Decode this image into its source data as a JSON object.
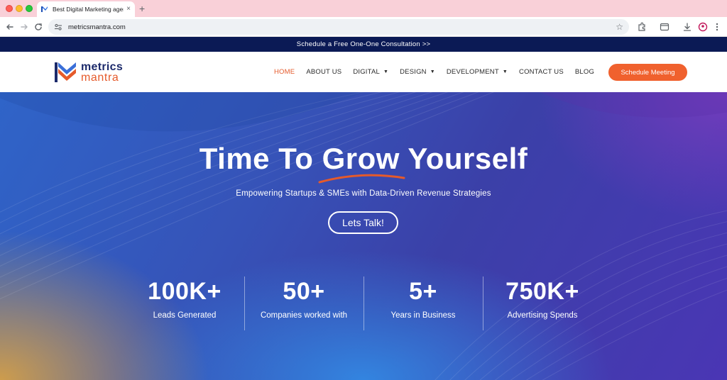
{
  "browser": {
    "tab_title": "Best Digital Marketing agency",
    "tab_close": "×",
    "new_tab": "+",
    "url": "metricsmantra.com"
  },
  "announcement": {
    "text": "Schedule a Free One-One Consultation >>"
  },
  "header": {
    "logo": {
      "line1": "metrics",
      "line2": "mantra"
    },
    "nav": [
      {
        "label": "HOME",
        "active": true,
        "dropdown": false
      },
      {
        "label": "ABOUT US",
        "active": false,
        "dropdown": false
      },
      {
        "label": "DIGITAL",
        "active": false,
        "dropdown": true
      },
      {
        "label": "DESIGN",
        "active": false,
        "dropdown": true
      },
      {
        "label": "DEVELOPMENT",
        "active": false,
        "dropdown": true
      },
      {
        "label": "CONTACT US",
        "active": false,
        "dropdown": false
      },
      {
        "label": "BLOG",
        "active": false,
        "dropdown": false
      }
    ],
    "cta_label": "Schedule Meeting"
  },
  "hero": {
    "title_part1": "Time To ",
    "title_bold": "Grow",
    "title_part2": " Yourself",
    "subtitle": "Empowering Startups & SMEs with Data-Driven Revenue Strategies",
    "button_label": "Lets Talk!"
  },
  "stats": [
    {
      "value": "100K+",
      "label": "Leads Generated"
    },
    {
      "value": "50+",
      "label": "Companies worked with"
    },
    {
      "value": "5+",
      "label": "Years in Business"
    },
    {
      "value": "750K+",
      "label": "Advertising Spends"
    }
  ],
  "colors": {
    "accent": "#f0612e",
    "navy": "#0b1a55",
    "tab_strip": "#f9d0d8"
  }
}
